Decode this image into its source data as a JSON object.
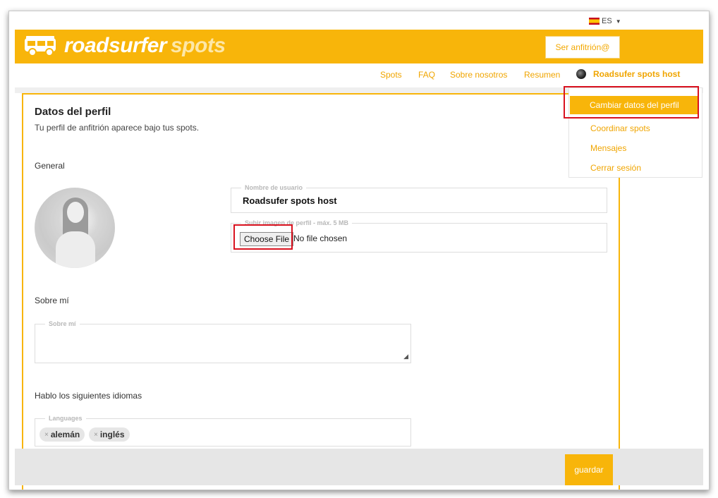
{
  "language": {
    "label": "ES"
  },
  "brand": {
    "name": "roadsurfer",
    "suffix": "spots"
  },
  "header": {
    "host_button": "Ser anfitrión@"
  },
  "nav": {
    "items": [
      "Spots",
      "FAQ",
      "Sobre nosotros",
      "Resumen"
    ],
    "user_name": "Roadsufer spots host"
  },
  "user_menu": {
    "items": [
      "Cambiar datos del perfil",
      "Coordinar spots",
      "Mensajes",
      "Cerrar sesión"
    ],
    "active_index": 0
  },
  "profile": {
    "title": "Datos del perfil",
    "subtitle": "Tu perfil de anfitrión aparece bajo tus spots.",
    "general_heading": "General",
    "username_legend": "Nombre de usuario",
    "username_value": "Roadsufer spots host",
    "upload_legend": "Subir imagen de perfil - máx. 5 MB",
    "upload_button": "Choose File",
    "upload_status": "No file chosen",
    "about_heading": "Sobre mí",
    "about_legend": "Sobre mí",
    "languages_heading": "Hablo los siguientes idiomas",
    "languages_legend": "Languages",
    "languages": [
      "alemán",
      "inglés"
    ]
  },
  "footer": {
    "save_button": "guardar"
  },
  "colors": {
    "accent": "#f8b50a",
    "highlight": "#d9121f"
  }
}
